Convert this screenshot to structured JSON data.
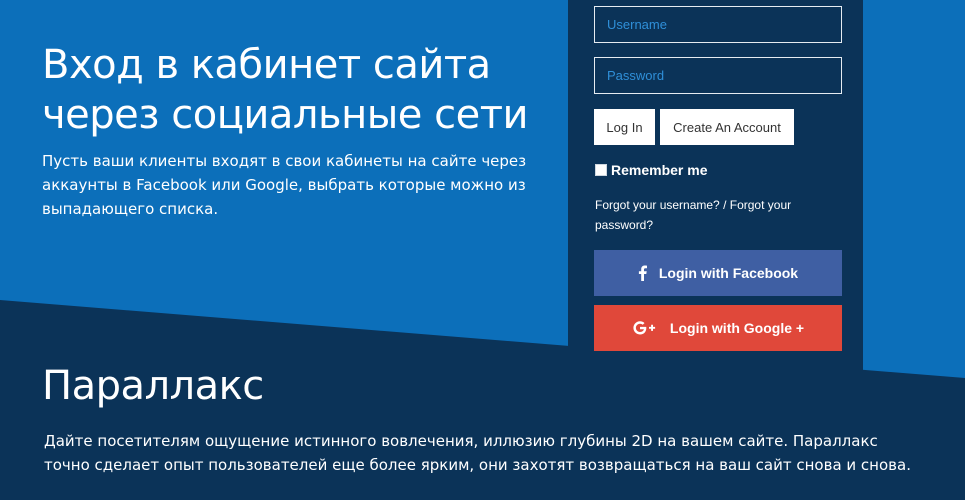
{
  "hero": {
    "title": "Вход в кабинет сайта через социальные сети",
    "description": "Пусть ваши клиенты входят в свои кабинеты на сайте через аккаунты в Facebook или Google, выбрать которые можно из выпадающего списка."
  },
  "login": {
    "username_placeholder": "Username",
    "password_placeholder": "Password",
    "login_label": "Log In",
    "create_account_label": "Create An Account",
    "remember_label": "Remember me",
    "forgot_username": "Forgot your username?",
    "forgot_separator": " / ",
    "forgot_password": "Forgot your password?",
    "facebook_label": "Login with Facebook",
    "google_label": "Login with Google +",
    "facebook_icon": "facebook-f-icon",
    "google_icon": "google-plus-icon"
  },
  "parallax": {
    "title": "Параллакс",
    "description": "Дайте посетителям ощущение истинного вовлечения, иллюзию глубины 2D на вашем сайте. Параллакс точно сделает опыт пользователей еще более ярким, они захотят возвращаться на ваш сайт снова и снова."
  },
  "colors": {
    "background_blue": "#0c6fba",
    "dark_navy": "#0b3358",
    "facebook": "#3f5fa3",
    "google": "#e0483a"
  }
}
